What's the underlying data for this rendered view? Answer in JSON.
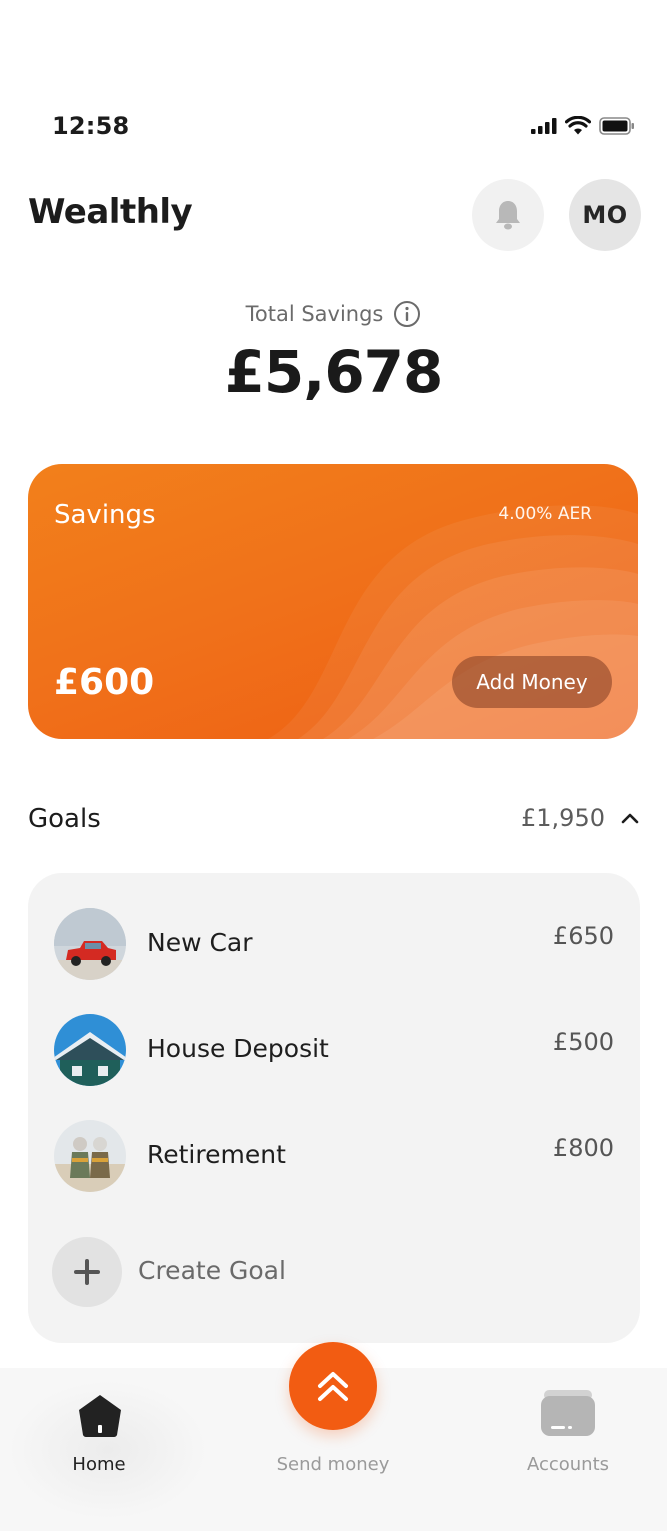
{
  "status_bar": {
    "time": "12:58"
  },
  "header": {
    "app_title": "Wealthly",
    "avatar_initials": "MO"
  },
  "summary": {
    "label": "Total Savings",
    "amount": "£5,678"
  },
  "savings_card": {
    "title": "Savings",
    "rate": "4.00% AER",
    "amount": "£600",
    "action_label": "Add Money",
    "colors": {
      "start": "#f2801b",
      "end": "#ee5d12"
    }
  },
  "goals": {
    "title": "Goals",
    "total": "£1,950",
    "items": [
      {
        "name": "New Car",
        "amount": "£650",
        "icon": "car-photo"
      },
      {
        "name": "House Deposit",
        "amount": "£500",
        "icon": "house-photo"
      },
      {
        "name": "Retirement",
        "amount": "£800",
        "icon": "beach-couple-photo"
      }
    ],
    "create_label": "Create Goal"
  },
  "nav": {
    "items": [
      {
        "label": "Home",
        "icon": "home-icon",
        "active": true
      },
      {
        "label": "Send money",
        "icon": "double-chevron-up-icon",
        "active": false
      },
      {
        "label": "Accounts",
        "icon": "card-icon",
        "active": false
      }
    ]
  },
  "colors": {
    "accent": "#f25c12",
    "text": "#1c1c1c",
    "muted": "#9a9a9a"
  }
}
